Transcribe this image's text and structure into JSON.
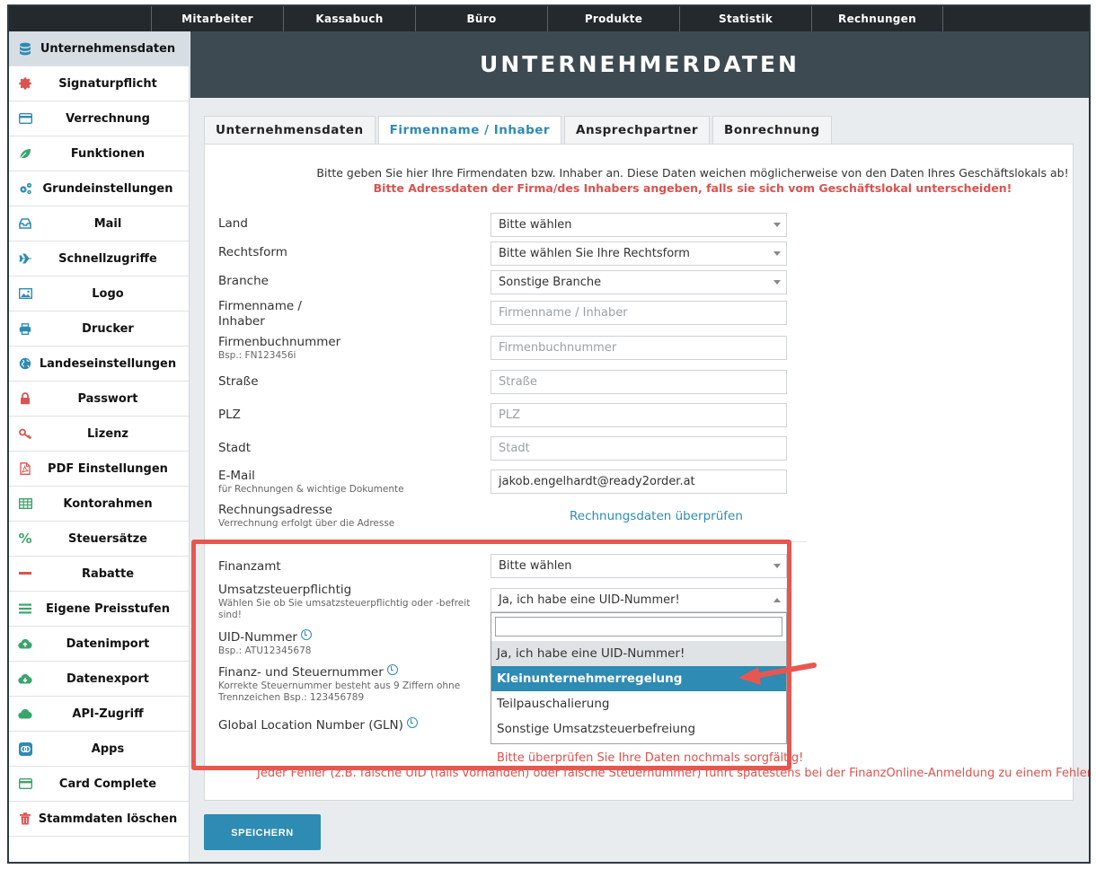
{
  "topnav": {
    "items": [
      "Mitarbeiter",
      "Kassabuch",
      "Büro",
      "Produkte",
      "Statistik",
      "Rechnungen"
    ]
  },
  "sidebar": {
    "items": [
      {
        "label": "Unternehmensdaten",
        "icon": "database-icon",
        "color": "#2e8bb3",
        "active": true
      },
      {
        "label": "Signaturpflicht",
        "icon": "seal-icon",
        "color": "#d9534f"
      },
      {
        "label": "Verrechnung",
        "icon": "card-icon",
        "color": "#2e8bb3"
      },
      {
        "label": "Funktionen",
        "icon": "leaf-icon",
        "color": "#3aa56b"
      },
      {
        "label": "Grundeinstellungen",
        "icon": "gears-icon",
        "color": "#2e8bb3"
      },
      {
        "label": "Mail",
        "icon": "inbox-icon",
        "color": "#2e8bb3"
      },
      {
        "label": "Schnellzugriffe",
        "icon": "plane-icon",
        "color": "#2e8bb3"
      },
      {
        "label": "Logo",
        "icon": "image-icon",
        "color": "#2e8bb3"
      },
      {
        "label": "Drucker",
        "icon": "printer-icon",
        "color": "#2e8bb3"
      },
      {
        "label": "Landeseinstellungen",
        "icon": "globe-icon",
        "color": "#2e8bb3"
      },
      {
        "label": "Passwort",
        "icon": "lock-icon",
        "color": "#d9534f"
      },
      {
        "label": "Lizenz",
        "icon": "key-icon",
        "color": "#d9534f"
      },
      {
        "label": "PDF Einstellungen",
        "icon": "pdf-icon",
        "color": "#d9534f"
      },
      {
        "label": "Kontorahmen",
        "icon": "table-icon",
        "color": "#3aa56b"
      },
      {
        "label": "Steuersätze",
        "icon": "percent-icon",
        "color": "#3aa56b"
      },
      {
        "label": "Rabatte",
        "icon": "minus-icon",
        "color": "#d9534f"
      },
      {
        "label": "Eigene Preisstufen",
        "icon": "list-icon",
        "color": "#3aa56b"
      },
      {
        "label": "Datenimport",
        "icon": "cloud-upload-icon",
        "color": "#3aa56b"
      },
      {
        "label": "Datenexport",
        "icon": "cloud-download-icon",
        "color": "#3aa56b"
      },
      {
        "label": "API-Zugriff",
        "icon": "cloud-icon",
        "color": "#3aa56b"
      },
      {
        "label": "Apps",
        "icon": "apps-icon",
        "color": "#2e8bb3"
      },
      {
        "label": "Card Complete",
        "icon": "creditcard-icon",
        "color": "#3aa56b"
      },
      {
        "label": "Stammdaten löschen",
        "icon": "trash-icon",
        "color": "#d9534f"
      }
    ]
  },
  "header": {
    "title": "UNTERNEHMERDATEN"
  },
  "tabs": [
    "Unternehmensdaten",
    "Firmenname / Inhaber",
    "Ansprechpartner",
    "Bonrechnung"
  ],
  "intro": {
    "line1": "Bitte geben Sie hier Ihre Firmendaten bzw. Inhaber an. Diese Daten weichen möglicherweise von den Daten Ihres Geschäftslokals ab!",
    "line2": "Bitte Adressdaten der Firma/des Inhabers angeben, falls sie sich vom Geschäftslokal unterscheiden!"
  },
  "form": {
    "land": {
      "label": "Land",
      "value": "Bitte wählen"
    },
    "rechtsform": {
      "label": "Rechtsform",
      "value": "Bitte wählen Sie Ihre Rechtsform"
    },
    "branche": {
      "label": "Branche",
      "value": "Sonstige Branche"
    },
    "firmenname": {
      "label_line1": "Firmenname /",
      "label_line2": "Inhaber",
      "placeholder": "Firmenname / Inhaber"
    },
    "firmenbuch": {
      "label": "Firmenbuchnummer",
      "sub": "Bsp.: FN123456i",
      "placeholder": "Firmenbuchnummer"
    },
    "strasse": {
      "label": "Straße",
      "placeholder": "Straße"
    },
    "plz": {
      "label": "PLZ",
      "placeholder": "PLZ"
    },
    "stadt": {
      "label": "Stadt",
      "placeholder": "Stadt"
    },
    "email": {
      "label": "E-Mail",
      "sub": "für Rechnungen & wichtige Dokumente",
      "value": "jakob.engelhardt@ready2order.at"
    },
    "rechnungsadresse": {
      "label": "Rechnungsadresse",
      "sub": "Verrechnung erfolgt über die Adresse",
      "link": "Rechnungsdaten überprüfen"
    },
    "finanzamt": {
      "label": "Finanzamt",
      "value": "Bitte wählen"
    },
    "ust": {
      "label": "Umsatzsteuerpflichtig",
      "sub": "Wählen Sie ob Sie umsatzsteuerpflichtig oder -befreit sind!",
      "value": "Ja, ich habe eine UID-Nummer!"
    },
    "uid": {
      "label": "UID-Nummer",
      "sub": "Bsp.: ATU12345678"
    },
    "steuernummer": {
      "label": "Finanz- und Steuernummer",
      "sub": "Korrekte Steuernummer besteht aus 9 Ziffern ohne Trennzeichen Bsp.: 123456789"
    },
    "gln": {
      "label": "Global Location Number (GLN)"
    }
  },
  "dropdown": {
    "options": [
      "Ja, ich habe eine UID-Nummer!",
      "Kleinunternehmerregelung",
      "Teilpauschalierung",
      "Sonstige Umsatzsteuerbefreiung"
    ],
    "highlighted": "Kleinunternehmerregelung"
  },
  "warnings": {
    "check": "Bitte überprüfen Sie Ihre Daten nochmals sorgfältig!",
    "error": "Jeder Fehler (z.B. falsche UID (falls vorhanden) oder falsche Steuernummer) führt spätestens bei der FinanzOnline-Anmeldung zu einem Fehler!"
  },
  "save_label": "SPEICHERN",
  "colors": {
    "accent": "#2e8bb3",
    "annotation": "#e8574f",
    "danger": "#d9534f",
    "header": "#3e4a51",
    "nav": "#23292d"
  }
}
